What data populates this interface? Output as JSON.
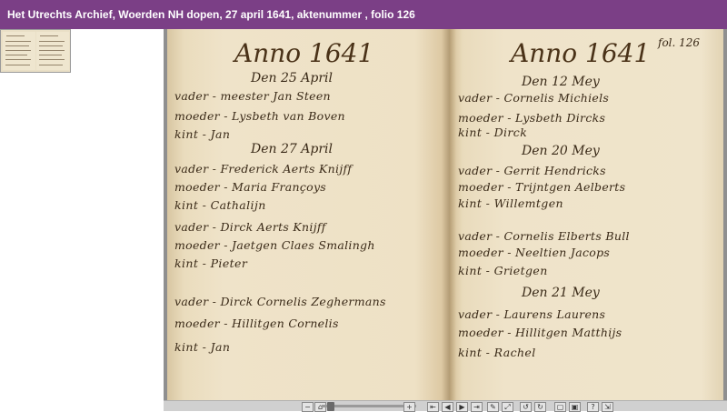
{
  "header": {
    "title": "Het Utrechts Archief, Woerden NH dopen, 27 april 1641, aktenummer , folio 126"
  },
  "document": {
    "left_page": {
      "year": "Anno 1641",
      "entries": [
        {
          "date": "Den 25 April",
          "father": "vader - meester Jan Steen",
          "mother": "moeder - Lysbeth van Boven",
          "child": "kint - Jan"
        },
        {
          "date": "Den 27 April",
          "father": "vader - Frederick Aerts Knijff",
          "mother": "moeder - Maria Françoys",
          "child": "kint - Cathalijn"
        },
        {
          "date": "",
          "father": "vader - Dirck Aerts Knijff",
          "mother": "moeder - Jaetgen Claes Smalingh",
          "child": "kint - Pieter"
        },
        {
          "date": "",
          "father": "vader - Dirck Cornelis Zeghermans",
          "mother": "moeder - Hillitgen Cornelis",
          "child": "kint - Jan"
        }
      ]
    },
    "right_page": {
      "year": "Anno 1641",
      "folio": "fol. 126",
      "entries": [
        {
          "date": "Den 12 Mey",
          "father": "vader - Cornelis Michiels",
          "mother": "moeder - Lysbeth Dircks",
          "child": "kint - Dirck"
        },
        {
          "date": "Den 20 Mey",
          "father": "vader - Gerrit Hendricks",
          "mother": "moeder - Trijntgen Aelberts",
          "child": "kint - Willemtgen"
        },
        {
          "date": "",
          "father": "vader - Cornelis Elberts Bull",
          "mother": "moeder - Neeltien Jacops",
          "child": "kint - Grietgen"
        },
        {
          "date": "Den 21 Mey",
          "father": "vader - Laurens Laurens",
          "mother": "moeder - Hillitgen Matthijs",
          "child": "kint - Rachel"
        }
      ]
    }
  },
  "toolbar": {
    "zoom_out": "−",
    "zoom_in": "+",
    "buttons": [
      "⇤",
      "◀",
      "▶",
      "⇥",
      "✎",
      "⤢",
      "↺",
      "↻",
      "▢",
      "▣",
      "?",
      "⇲"
    ]
  }
}
